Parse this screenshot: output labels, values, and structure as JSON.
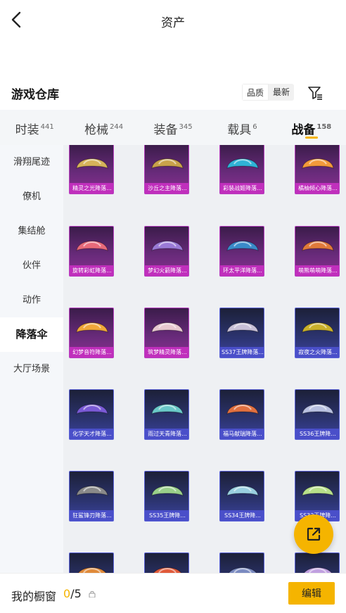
{
  "header": {
    "title": "资产"
  },
  "section": {
    "title": "游戏仓库"
  },
  "sort": {
    "quality_label": "品质",
    "latest_label": "最新"
  },
  "tabs": [
    {
      "label": "时装",
      "count": "441"
    },
    {
      "label": "枪械",
      "count": "244"
    },
    {
      "label": "装备",
      "count": "345"
    },
    {
      "label": "载具",
      "count": "6"
    },
    {
      "label": "战备",
      "count": "158"
    }
  ],
  "categories": [
    "滑翔尾迹",
    "僚机",
    "集结舱",
    "伙伴",
    "动作",
    "降落伞",
    "大厅场景"
  ],
  "items": [
    {
      "label": "精灵之光降落...",
      "rarity": "purple",
      "color": "#d6b35a"
    },
    {
      "label": "沙丘之主降落...",
      "rarity": "purple",
      "color": "#c9a24a"
    },
    {
      "label": "彩装战姬降落...",
      "rarity": "purple",
      "color": "#2fb3d6"
    },
    {
      "label": "橘柚倾心降落...",
      "rarity": "purple",
      "color": "#f39a3a"
    },
    {
      "label": "旋转彩虹降落...",
      "rarity": "purple",
      "color": "#e86a7a"
    },
    {
      "label": "梦幻火箭降落...",
      "rarity": "purple",
      "color": "#9a7ad6"
    },
    {
      "label": "环太平洋降落...",
      "rarity": "purple",
      "color": "#3a8ac9"
    },
    {
      "label": "萌熊萌萌降落...",
      "rarity": "purple",
      "color": "#e07a3a"
    },
    {
      "label": "幻梦音符降落...",
      "rarity": "purple",
      "color": "#f0a83a"
    },
    {
      "label": "筑梦精灵降落...",
      "rarity": "purple",
      "color": "#e8c8d0"
    },
    {
      "label": "SS37王牌降落...",
      "rarity": "blue",
      "color": "#c8c0d8"
    },
    {
      "label": "寂夜之火降落...",
      "rarity": "blue",
      "color": "#c9b02a"
    },
    {
      "label": "化学天才降落...",
      "rarity": "blue",
      "color": "#7a5ad6"
    },
    {
      "label": "雨过天青降落...",
      "rarity": "blue",
      "color": "#6ac8c8"
    },
    {
      "label": "福马献瑞降落...",
      "rarity": "blue",
      "color": "#e07040"
    },
    {
      "label": "SS36王牌降...",
      "rarity": "blue",
      "color": "#b8c0e0"
    },
    {
      "label": "狂鲨锋刃降落...",
      "rarity": "blue",
      "color": "#8a8a8a"
    },
    {
      "label": "SS35王牌降...",
      "rarity": "blue",
      "color": "#9ad08a"
    },
    {
      "label": "SS34王牌降...",
      "rarity": "blue",
      "color": "#9ad0e0"
    },
    {
      "label": "SS33王牌降...",
      "rarity": "blue",
      "color": "#b8e08a"
    },
    {
      "label": "",
      "rarity": "blue",
      "color": "#e08a3a"
    },
    {
      "label": "",
      "rarity": "blue",
      "color": "#e05a3a"
    },
    {
      "label": "",
      "rarity": "blue",
      "color": "#7a8ac0"
    },
    {
      "label": "",
      "rarity": "blue",
      "color": "#c0a0e0"
    }
  ],
  "footer": {
    "showcase_label": "我的橱窗",
    "count_current": "0",
    "count_sep_total": "/5",
    "edit_label": "编辑"
  },
  "colors": {
    "accent": "#f5b400",
    "rare_purple": "#c02fbc",
    "rare_blue": "#4a4fc9"
  }
}
